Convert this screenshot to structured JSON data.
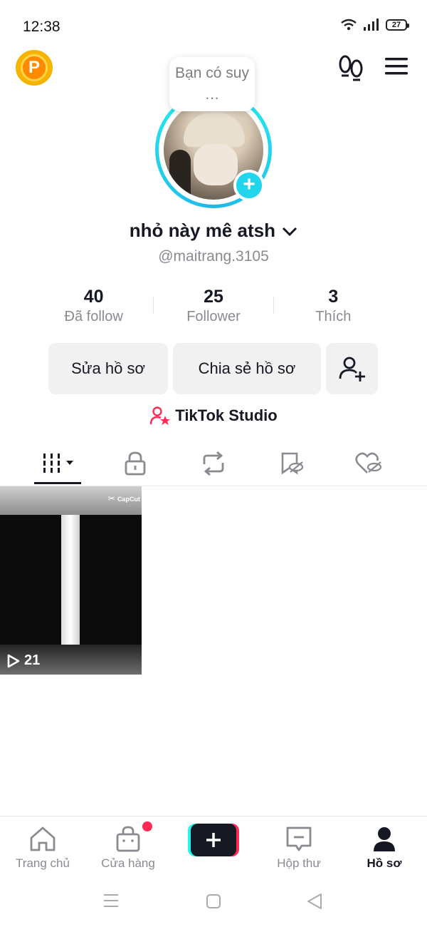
{
  "status_bar": {
    "time": "12:38",
    "battery": "27"
  },
  "profile_note": "Bạn có suy …",
  "profile": {
    "display_name": "nhỏ này mê atsh",
    "username": "@maitrang.3105"
  },
  "stats": [
    {
      "value": "40",
      "label": "Đã follow"
    },
    {
      "value": "25",
      "label": "Follower"
    },
    {
      "value": "3",
      "label": "Thích"
    }
  ],
  "actions": {
    "edit_profile": "Sửa hồ sơ",
    "share_profile": "Chia sẻ hồ sơ"
  },
  "studio_link": "TikTok Studio",
  "tabs": [
    "videos-grid-icon",
    "lock-icon",
    "repost-icon",
    "favorites-icon",
    "liked-icon"
  ],
  "videos": [
    {
      "views": "21",
      "watermark": "CapCut"
    }
  ],
  "bottom_nav": {
    "home": "Trang chủ",
    "shop": "Cửa hàng",
    "inbox": "Hộp thư",
    "profile": "Hồ sơ"
  },
  "colors": {
    "accent_teal": "#20d5ec",
    "accent_red": "#fe2c55",
    "text": "#161823",
    "muted": "#8a8b91"
  }
}
